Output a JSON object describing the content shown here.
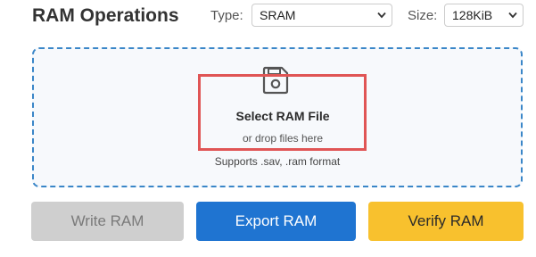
{
  "header": {
    "title": "RAM Operations",
    "type_label": "Type:",
    "type_value": "SRAM",
    "size_label": "Size:",
    "size_value": "128KiB"
  },
  "dropzone": {
    "title": "Select RAM File",
    "subtitle": "or drop files here",
    "formats": "Supports .sav, .ram format",
    "icon": "file-icon"
  },
  "actions": {
    "write_label": "Write RAM",
    "export_label": "Export RAM",
    "verify_label": "Verify RAM"
  },
  "colors": {
    "dropzone_border": "#3a86c8",
    "highlight": "#e05555",
    "write_bg": "#cfcfcf",
    "export_bg": "#1f74d1",
    "verify_bg": "#f8c12e"
  }
}
